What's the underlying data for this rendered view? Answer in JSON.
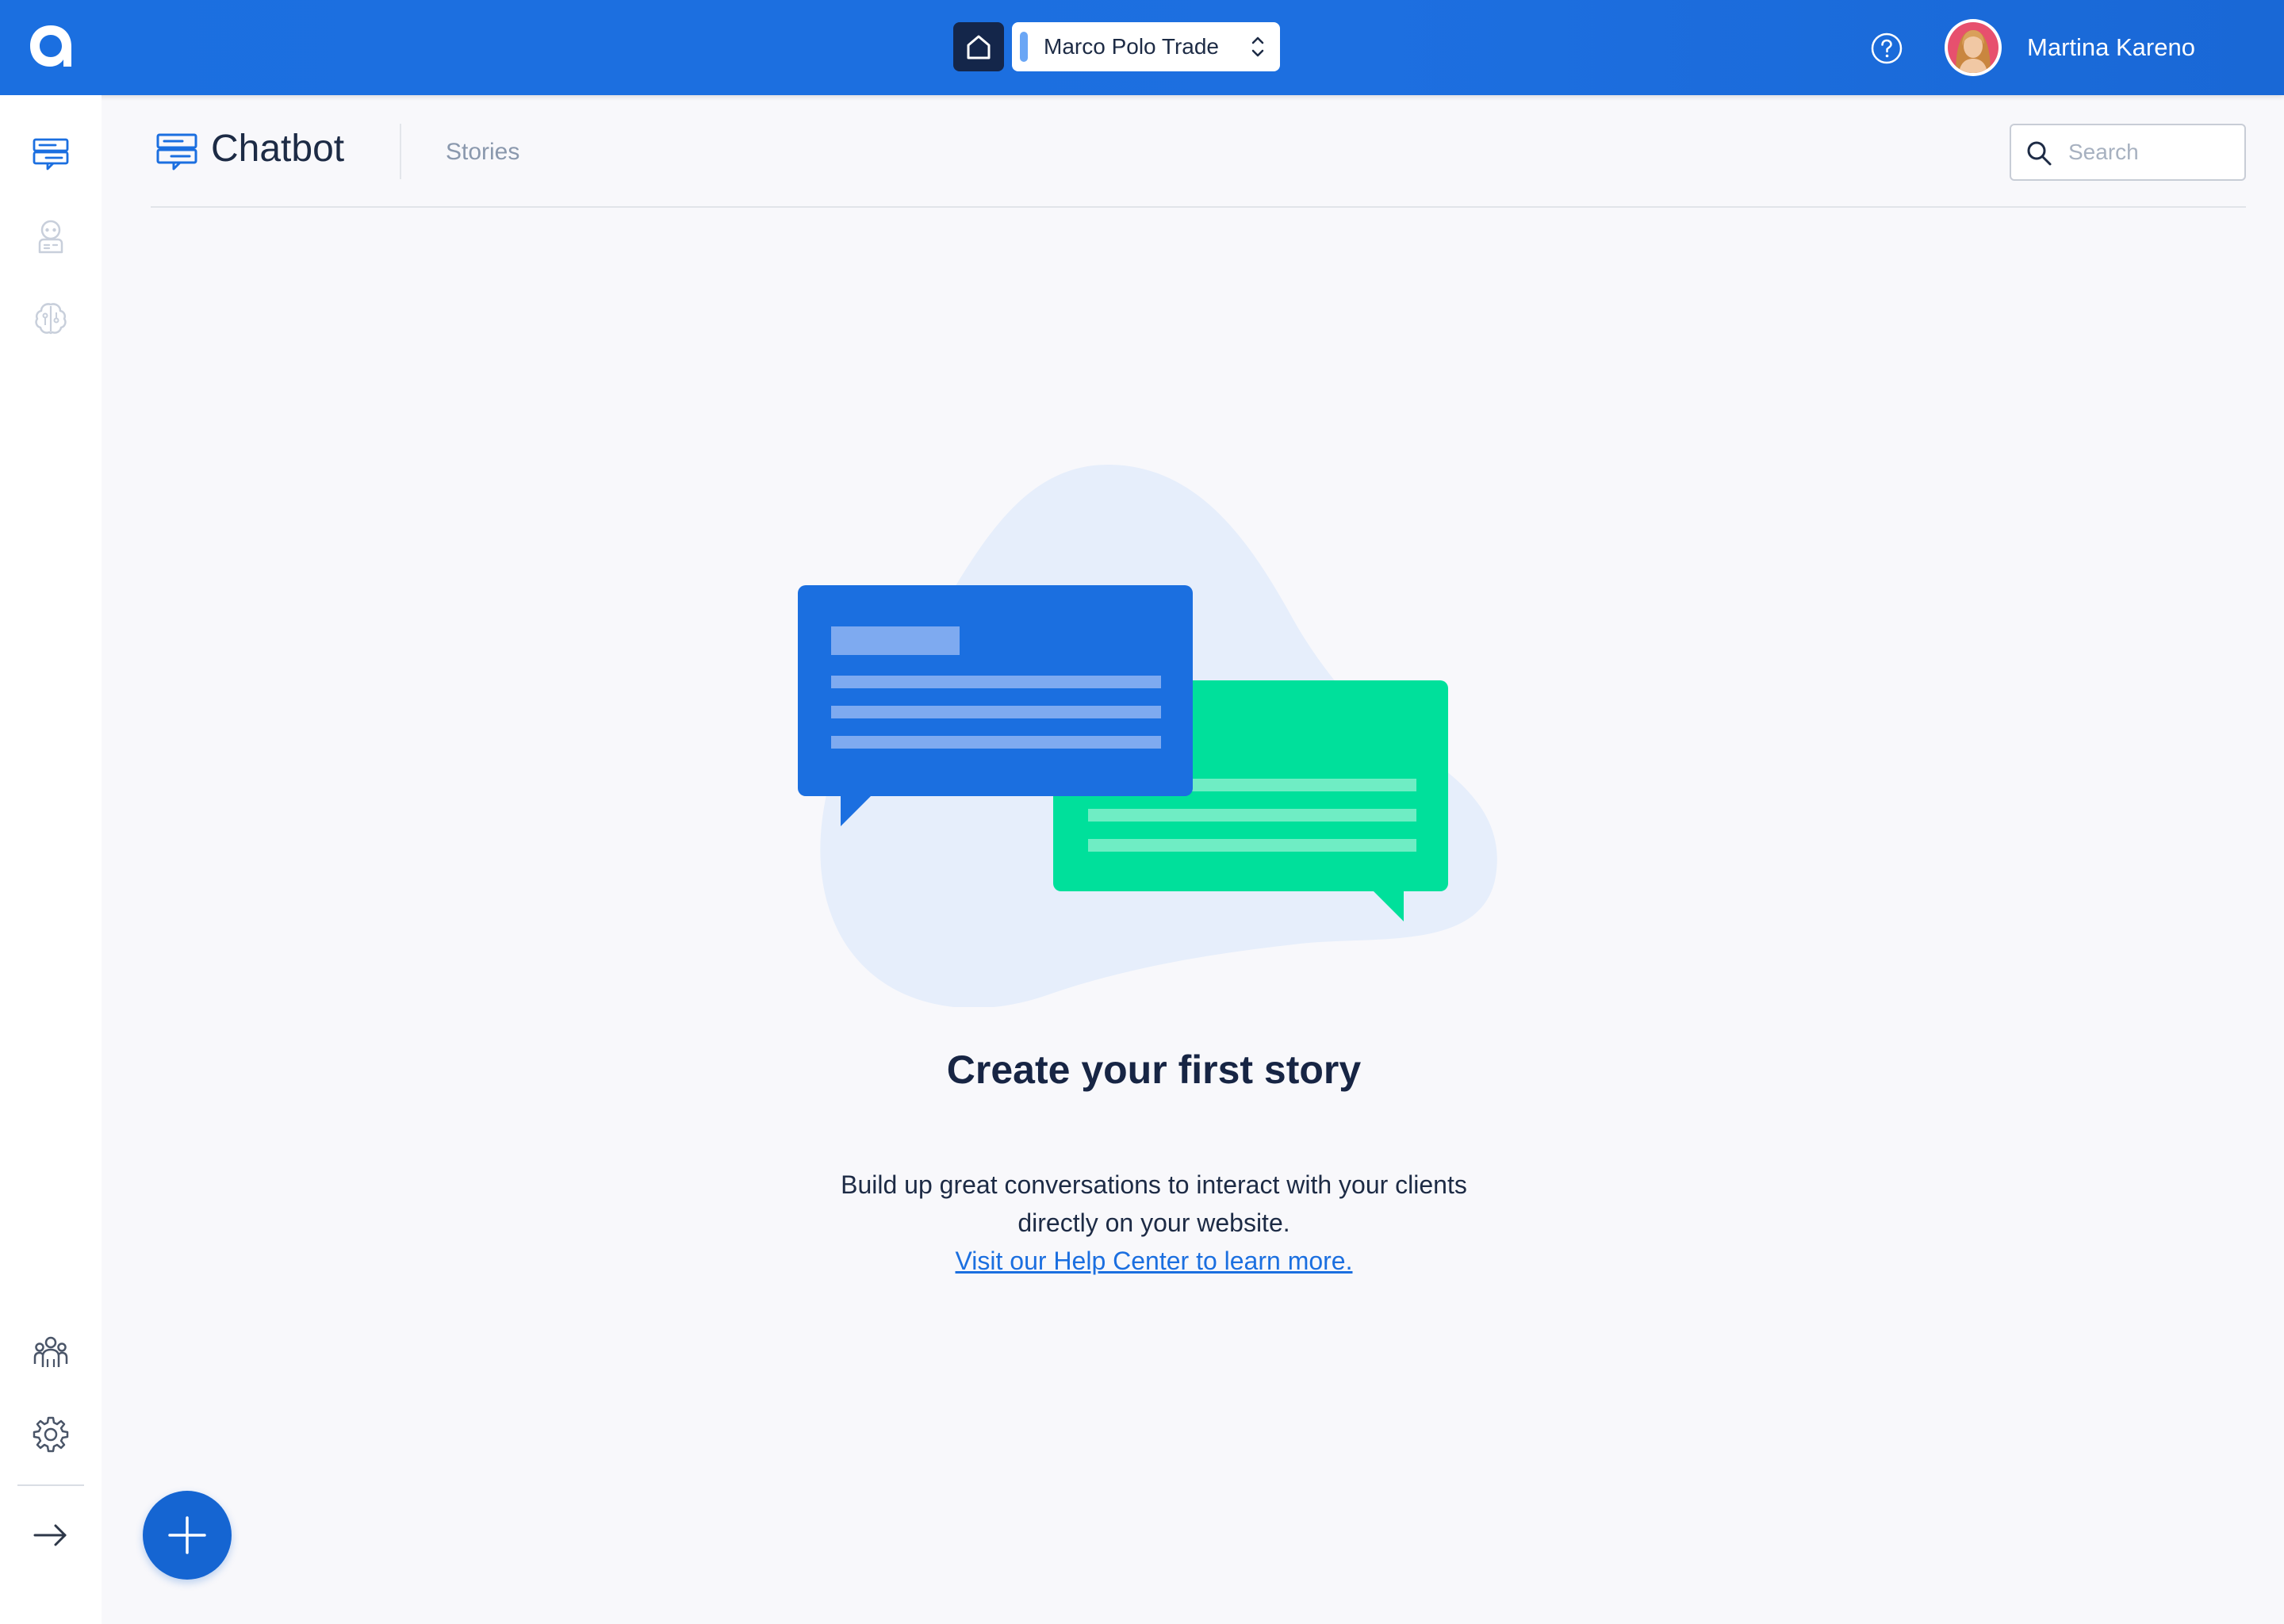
{
  "topbar": {
    "logo_icon": "app-logo-a",
    "home_icon": "home-icon",
    "workspace": {
      "name": "Marco Polo Trade",
      "chevron_icon": "chevron-updown-icon"
    },
    "help_icon": "help-circle-icon",
    "user": {
      "name": "Martina Kareno",
      "avatar_icon": "user-avatar"
    }
  },
  "rail": {
    "top_items": [
      {
        "icon": "chatbot-icon",
        "active": true
      },
      {
        "icon": "robot-icon",
        "active": false
      },
      {
        "icon": "brain-icon",
        "active": false
      }
    ],
    "bottom_items": [
      {
        "icon": "team-icon"
      },
      {
        "icon": "gear-icon"
      },
      {
        "icon": "arrow-right-icon"
      }
    ]
  },
  "header": {
    "title": "Chatbot",
    "title_icon": "chatbot-icon",
    "tabs": [
      {
        "label": "Stories"
      }
    ],
    "search": {
      "placeholder": "Search",
      "value": ""
    }
  },
  "empty_state": {
    "title": "Create your first story",
    "description_line1": "Build up great conversations to interact with your clients",
    "description_line2": "directly on your website.",
    "link_text": "Visit our Help Center to learn more."
  },
  "fab": {
    "icon": "plus-icon"
  },
  "colors": {
    "brand_blue": "#1b6fe0",
    "navy": "#14264a",
    "green": "#00e09b",
    "blob": "#e8f0fb",
    "background": "#f8f8fb"
  }
}
